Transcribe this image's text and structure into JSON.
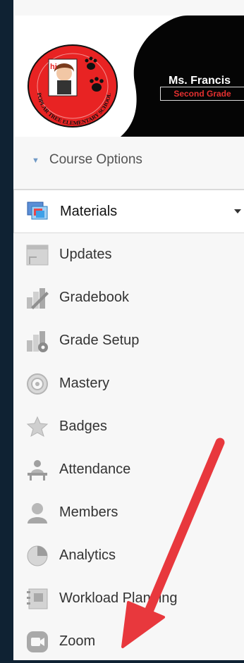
{
  "banner": {
    "teacher_name": "Ms. Francis",
    "grade_label": "Second Grade",
    "logo_ring_text": "POPLAR TREE ELEMENTARY SCHOOL",
    "logo_hi_text": "hi"
  },
  "course_options": {
    "label": "Course Options"
  },
  "menu": {
    "items": [
      {
        "label": "Materials",
        "icon": "materials-icon",
        "active": true
      },
      {
        "label": "Updates",
        "icon": "updates-icon"
      },
      {
        "label": "Gradebook",
        "icon": "gradebook-icon"
      },
      {
        "label": "Grade Setup",
        "icon": "grade-setup-icon"
      },
      {
        "label": "Mastery",
        "icon": "mastery-icon"
      },
      {
        "label": "Badges",
        "icon": "badges-icon"
      },
      {
        "label": "Attendance",
        "icon": "attendance-icon"
      },
      {
        "label": "Members",
        "icon": "members-icon"
      },
      {
        "label": "Analytics",
        "icon": "analytics-icon"
      },
      {
        "label": "Workload Planning",
        "icon": "workload-planning-icon"
      },
      {
        "label": "Zoom",
        "icon": "zoom-icon"
      }
    ]
  },
  "colors": {
    "background": "#0f2233",
    "panel": "#f7f7f7",
    "accent_blue": "#6f99c6",
    "annotation_arrow": "#e8383d",
    "logo_red": "#e82323"
  }
}
